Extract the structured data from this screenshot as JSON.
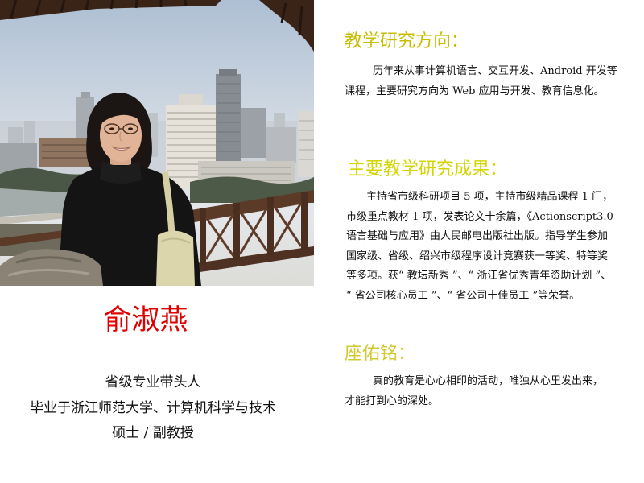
{
  "profile": {
    "name": "俞淑燕",
    "title": "省级专业带头人",
    "education": "毕业于浙江师范大学、计算机科学与技术",
    "degree": "硕士 / 副教授"
  },
  "sections": [
    {
      "heading": "教学研究方向：",
      "lines": [
        "历年来从事计算机语言、交互开发、Android 开发等",
        "课程，主要研究方向为 Web 应用与开发、教育信息化。"
      ]
    },
    {
      "heading": "主要教学研究成果：",
      "lines": [
        "主持省市级科研项目 5 项，主持市级精品课程 1 门，",
        "市级重点教材 1 项，发表论文十余篇，《Actionscript3.0",
        "语言基础与应用》由人民邮电出版社出版。指导学生参加",
        "国家级、省级、绍兴市级程序设计竞赛获一等奖、特等奖",
        "等多项。获“ 教坛新秀 ”、“ 浙江省优秀青年资助计划 ”、",
        "“ 省公司核心员工 ”、“ 省公司十佳员工 ”等荣誉。"
      ]
    },
    {
      "heading": "座佑铭：",
      "lines": [
        "真的教育是心心相印的活动，唯独从心里发出来，",
        "才能打到心的深处。"
      ]
    }
  ],
  "colors": {
    "name": "#e00000",
    "heading_1": "#c9bd00",
    "heading_2": "#d4d400",
    "heading_3": "#d2c830",
    "body_text": "#111111",
    "background": "#ffffff"
  }
}
